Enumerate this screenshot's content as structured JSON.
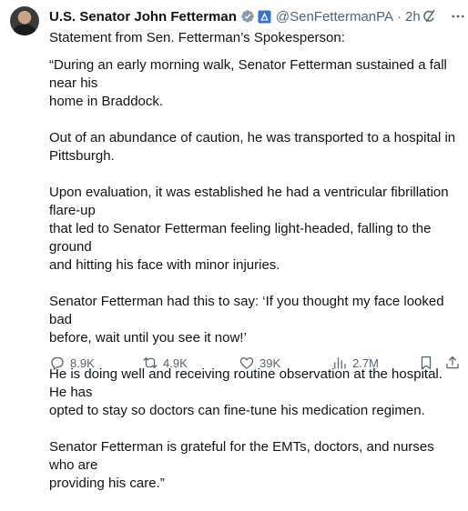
{
  "author": {
    "name": "U.S. Senator John Fetterman",
    "handle": "@SenFettermanPA",
    "separator": "·",
    "time": "2h"
  },
  "tweet": {
    "paragraphs": [
      "Statement from Sen. Fetterman’s Spokesperson:",
      "“During an early morning walk, Senator Fetterman sustained a fall near his\nhome in Braddock.",
      "Out of an abundance of caution, he was transported to a hospital in\nPittsburgh.",
      "Upon evaluation, it was established he had a ventricular fibrillation flare-up\nthat led to Senator Fetterman feeling light-headed, falling to the ground\nand hitting his face with minor injuries.",
      "Senator Fetterman had this to say: ‘If you thought my face looked bad\nbefore, wait until you see it now!’",
      "He is doing well and receiving routine observation at the hospital. He has\nopted to stay so doctors can fine-tune his medication regimen.",
      "Senator Fetterman is grateful for the EMTs, doctors, and nurses who are\nproviding his care.”"
    ]
  },
  "actions": {
    "replies": "8.9K",
    "reposts": "4.9K",
    "likes": "39K",
    "views": "2.7M"
  },
  "icons": {
    "verified": "verified-badge-icon",
    "government": "government-label-icon",
    "grok": "grok-icon",
    "more": "more-icon",
    "reply": "reply-icon",
    "repost": "repost-icon",
    "like": "heart-icon",
    "views": "views-chart-icon",
    "bookmark": "bookmark-icon",
    "share": "share-icon"
  },
  "colors": {
    "text": "#0f1419",
    "secondary": "#536471",
    "verified": "#1d9bf0"
  }
}
